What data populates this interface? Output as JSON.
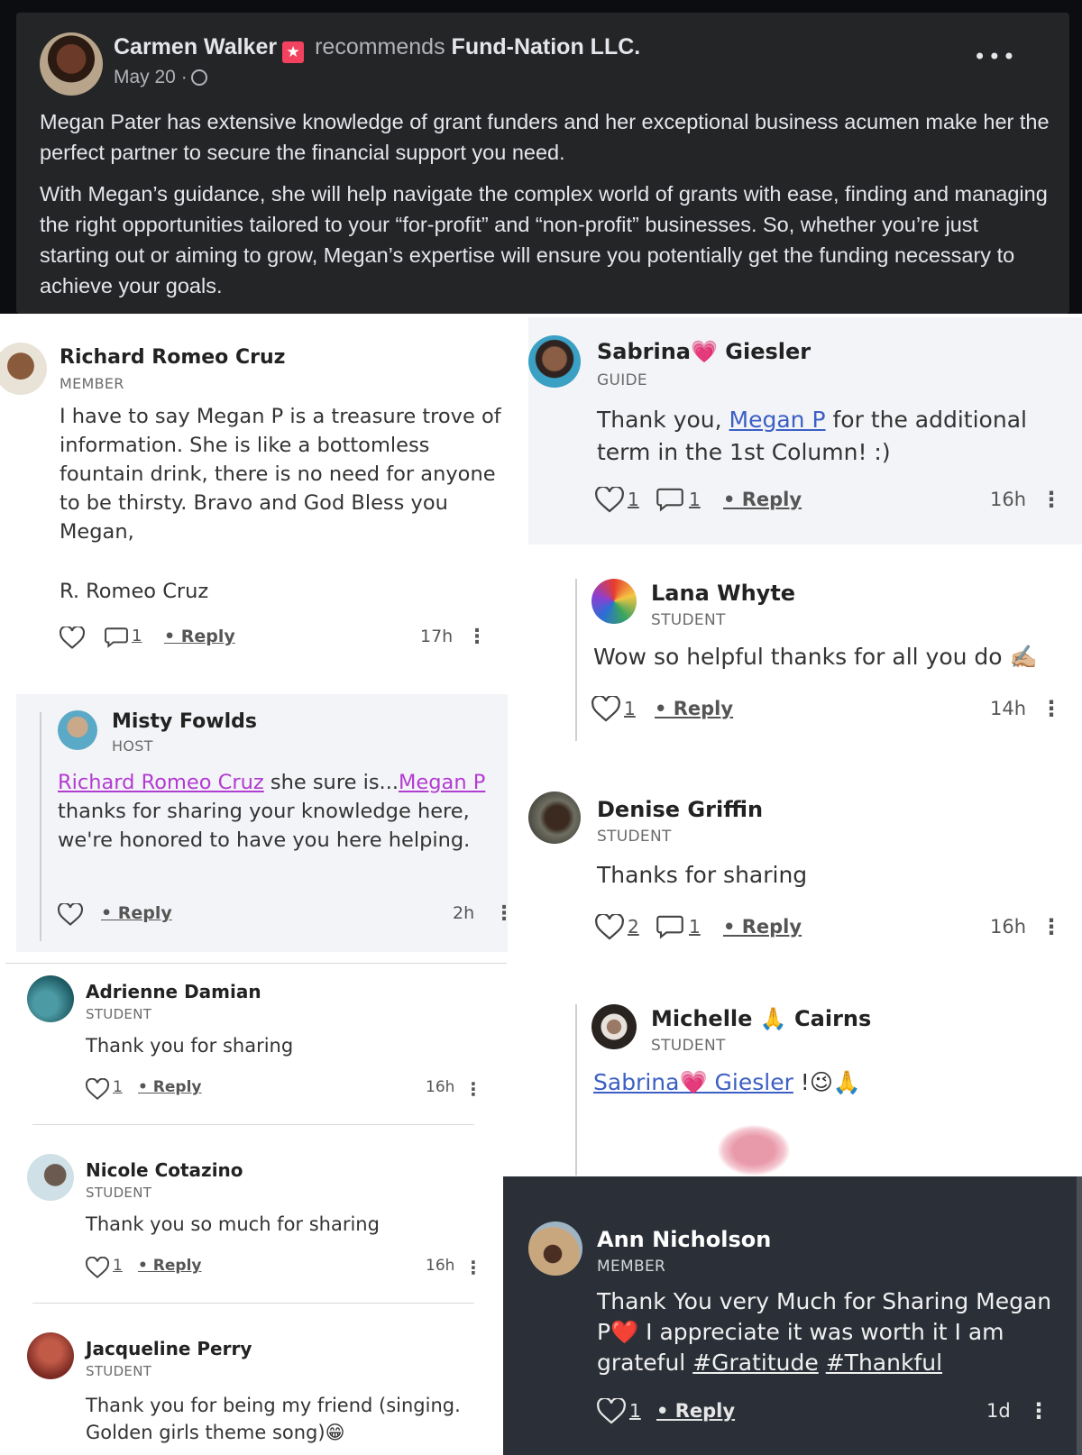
{
  "post": {
    "author": "Carmen Walker",
    "badge_icon": "star-badge-icon",
    "verb": "recommends",
    "page": "Fund-Nation LLC.",
    "date": "May 20 ·",
    "more": "•••",
    "paragraph1": "Megan Pater has extensive knowledge of grant funders and her exceptional business acumen make her the perfect partner to secure the financial support you need.",
    "paragraph2": "With Megan’s guidance, she will help navigate the complex world of grants with ease, finding and managing the right opportunities tailored to your “for-profit” and “non-profit” businesses. So, whether you’re just starting out or aiming to grow, Megan’s expertise will ensure you potentially get the funding necessary to achieve your goals."
  },
  "left": {
    "richard": {
      "name": "Richard Romeo Cruz",
      "role": "MEMBER",
      "text": "I have to say Megan P is a treasure trove of information. She is like a bottomless fountain drink, there is no need for anyone to be thirsty. Bravo and God Bless you Megan,",
      "signature": "R. Romeo Cruz",
      "replies": "1",
      "reply_label": "• Reply",
      "time": "17h",
      "more": "⋮"
    },
    "misty": {
      "name": "Misty Fowlds",
      "role": "HOST",
      "mention1": "Richard Romeo Cruz",
      "text1": " she sure is...",
      "mention2": "Megan P",
      "text2": " thanks for sharing your knowledge here, we're honored to have you here helping.",
      "reply_label": "• Reply",
      "time": "2h",
      "more": "⋮"
    },
    "adrienne": {
      "name": "Adrienne Damian",
      "role": "STUDENT",
      "text": "Thank you for sharing",
      "likes": "1",
      "reply_label": "• Reply",
      "time": "16h",
      "more": "⋮"
    },
    "nicole": {
      "name": "Nicole Cotazino",
      "role": "STUDENT",
      "text": "Thank you so much for sharing",
      "likes": "1",
      "reply_label": "• Reply",
      "time": "16h",
      "more": "⋮"
    },
    "jacqueline": {
      "name": "Jacqueline Perry",
      "role": "STUDENT",
      "text": "Thank you for being my friend (singing. Golden girls theme song)😁"
    }
  },
  "right": {
    "sabrina": {
      "name_first": "Sabrina",
      "name_emoji": "💗",
      "name_last": "Giesler",
      "role": "GUIDE",
      "text1": "Thank you, ",
      "mention": "Megan P",
      "text2": " for the additional term in the 1st Column! :)",
      "likes": "1",
      "replies": "1",
      "reply_label": "• Reply",
      "time": "16h",
      "more": "⋮"
    },
    "lana": {
      "name": "Lana Whyte",
      "role": "STUDENT",
      "text": "Wow so helpful thanks for all you do ✍🏼",
      "likes": "1",
      "reply_label": "• Reply",
      "time": "14h",
      "more": "⋮"
    },
    "denise": {
      "name": "Denise Griffin",
      "role": "STUDENT",
      "text": "Thanks for sharing",
      "likes": "2",
      "replies": "1",
      "reply_label": "• Reply",
      "time": "16h",
      "more": "⋮"
    },
    "michelle": {
      "name_first": "Michelle",
      "name_emoji": "🙏",
      "name_last": "Cairns",
      "role": "STUDENT",
      "mention": "Sabrina💗 Giesler",
      "text": " !😉🙏"
    },
    "ann": {
      "name": "Ann Nicholson",
      "role": "MEMBER",
      "text": "Thank You very Much for Sharing Megan P❤️ I appreciate it was worth it I am grateful ",
      "tag1": "#Gratitude",
      "tag2": "#Thankful",
      "likes": "1",
      "reply_label": "• Reply",
      "time": "1d",
      "more": "⋮"
    }
  },
  "colors": {
    "link": "#3b5fc4",
    "mention_host": "#b23bd1",
    "post_bg": "#242527",
    "dark_panel": "#2b3038"
  }
}
